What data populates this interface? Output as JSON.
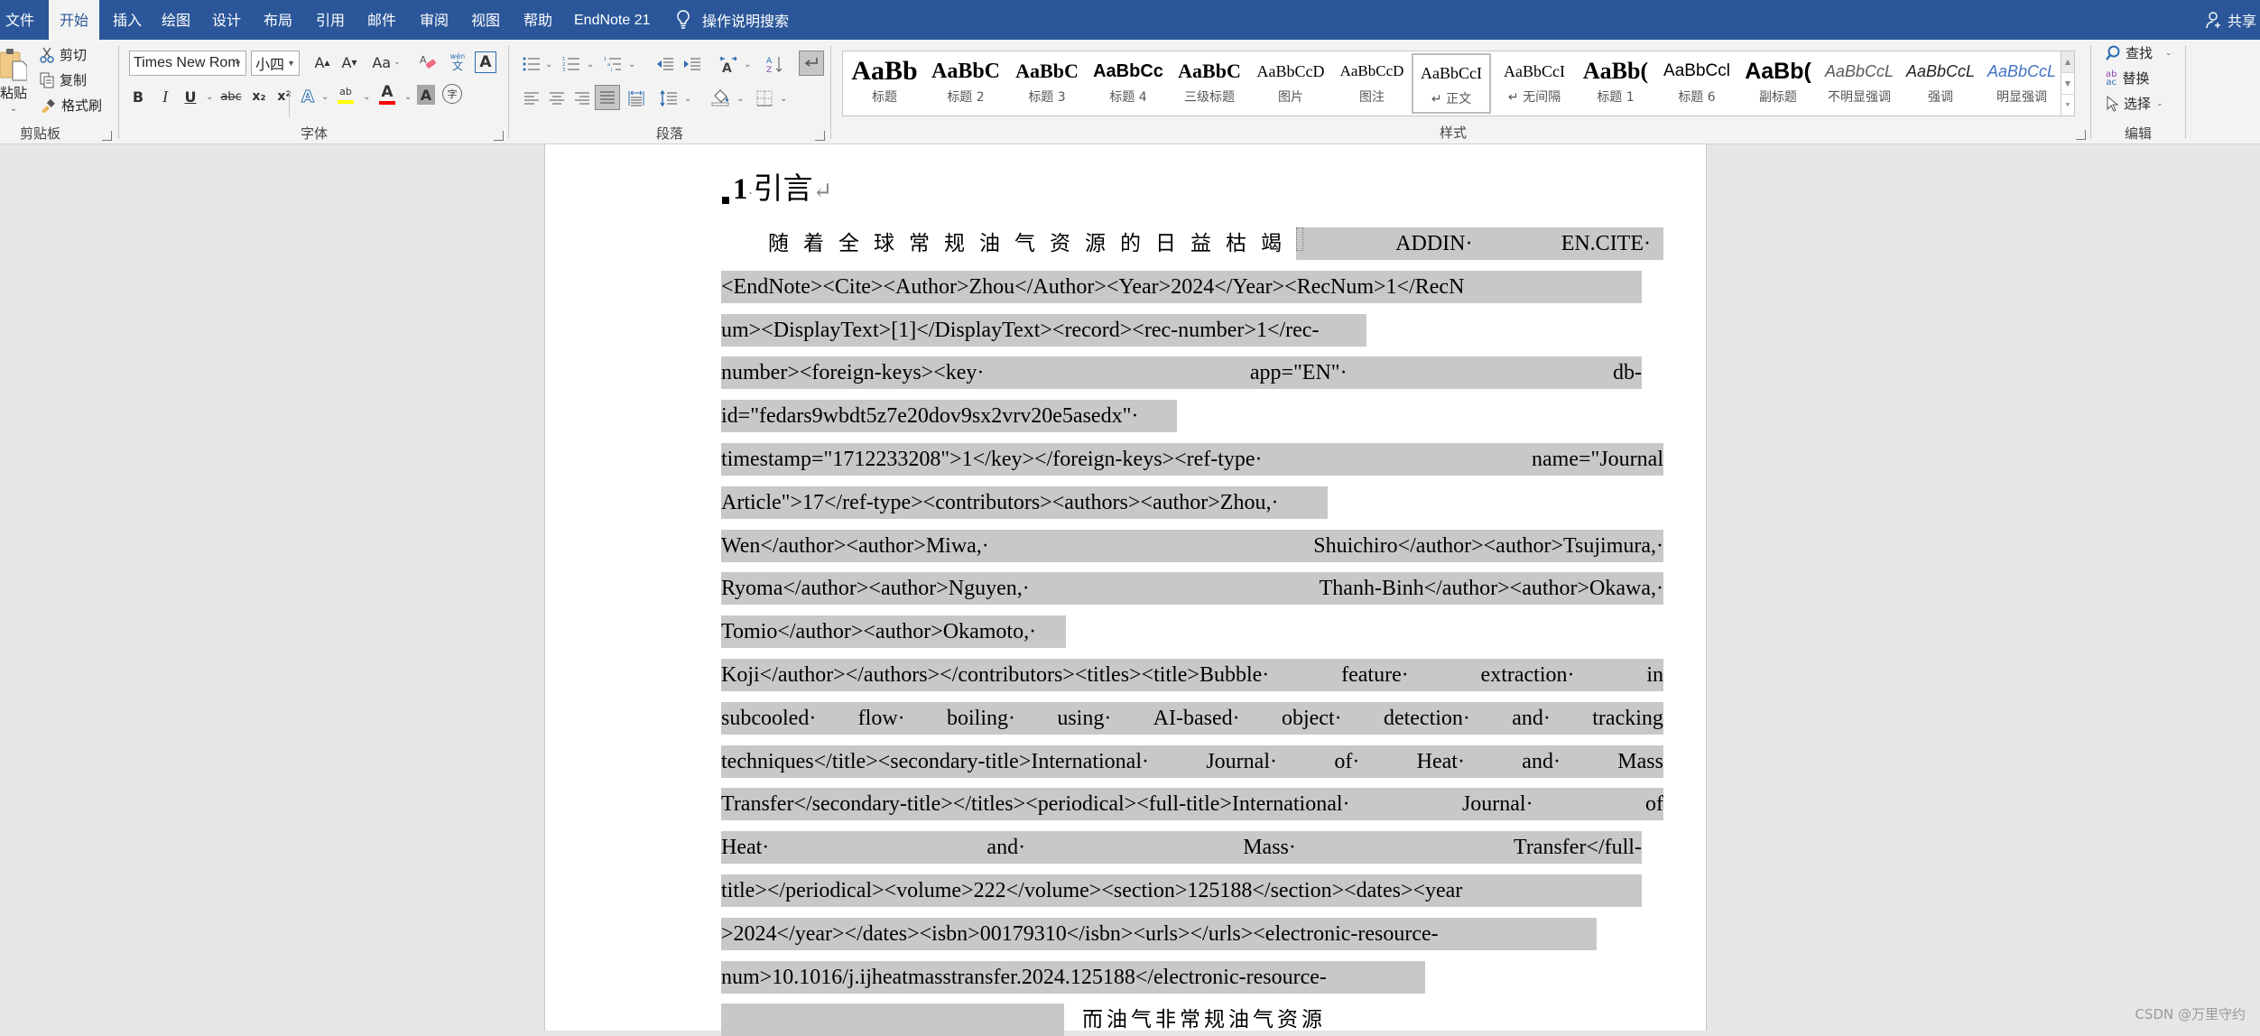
{
  "tabs": {
    "items": [
      {
        "label": "文件"
      },
      {
        "label": "开始"
      },
      {
        "label": "插入"
      },
      {
        "label": "绘图"
      },
      {
        "label": "设计"
      },
      {
        "label": "布局"
      },
      {
        "label": "引用"
      },
      {
        "label": "邮件"
      },
      {
        "label": "审阅"
      },
      {
        "label": "视图"
      },
      {
        "label": "帮助"
      },
      {
        "label": "EndNote 21"
      }
    ],
    "active": "开始",
    "tell_me": "操作说明搜索",
    "share": "共享"
  },
  "ribbon": {
    "clipboard": {
      "label": "剪贴板",
      "paste": "粘贴",
      "cut": "剪切",
      "copy": "复制",
      "format_painter": "格式刷"
    },
    "font": {
      "label": "字体",
      "font_name": "Times New Rom",
      "font_size": "小四",
      "grow": "A",
      "shrink": "A",
      "change_case": "Aa",
      "bold": "B",
      "italic": "I",
      "underline": "U",
      "strike": "abc",
      "subscript": "x₂",
      "superscript": "x²",
      "phonetic_top": "wén",
      "phonetic_bottom": "文",
      "char_border": "A",
      "text_effects": "A",
      "highlight": "ab",
      "highlight_color": "#ffff00",
      "font_color": "A",
      "font_color_value": "#ff0000",
      "char_shading": "A",
      "enclose": "字"
    },
    "paragraph": {
      "label": "段落"
    },
    "styles": {
      "label": "样式",
      "items": [
        {
          "preview": "AaBb",
          "name": "标题"
        },
        {
          "preview": "AaBbC",
          "name": "标题 2"
        },
        {
          "preview": "AaBbC",
          "name": "标题 3"
        },
        {
          "preview": "AaBbCc",
          "name": "标题 4"
        },
        {
          "preview": "AaBbC",
          "name": "三级标题"
        },
        {
          "preview": "AaBbCcD",
          "name": "图片"
        },
        {
          "preview": "AaBbCcD",
          "name": "图注"
        },
        {
          "preview": "AaBbCcI",
          "name": "↵ 正文"
        },
        {
          "preview": "AaBbCcI",
          "name": "↵ 无间隔"
        },
        {
          "preview": "AaBb(",
          "name": "标题 1"
        },
        {
          "preview": "AaBbCcl",
          "name": "标题 6"
        },
        {
          "preview": "AaBb(",
          "name": "副标题"
        },
        {
          "preview": "AaBbCcL",
          "name": "不明显强调"
        },
        {
          "preview": "AaBbCcL",
          "name": "强调"
        },
        {
          "preview": "AaBbCcL",
          "name": "明显强调"
        }
      ],
      "selected": "↵ 正文",
      "intense_emphasis_color": "#4472c4"
    },
    "editing": {
      "label": "编辑",
      "find": "查找",
      "replace": "替换",
      "select": "选择",
      "replace_icon_top": "ab",
      "replace_icon_bottom": "ac"
    }
  },
  "document": {
    "heading": {
      "number": "1",
      "text": "引言"
    },
    "intro_cjk": "随着全球常规油气资源的日益枯竭",
    "lines": [
      {
        "parts": [
          "ADDIN",
          "EN.CITE"
        ]
      },
      {
        "parts": [
          "<EndNote><Cite><Author>Zhou</Author><Year>2024</Year><RecNum>1</RecN"
        ]
      },
      {
        "parts": [
          "um><DisplayText>[1]</DisplayText><record><rec-number>1</rec-"
        ]
      },
      {
        "parts": [
          "number><foreign-keys><key",
          "app=\"EN\"",
          "db-"
        ]
      },
      {
        "parts": [
          "id=\"fedars9wbdt5z7e20dov9sx2vrv20e5asedx\""
        ]
      },
      {
        "parts": [
          "timestamp=\"1712233208\">1</key></foreign-keys><ref-type",
          "name=\"Journal"
        ]
      },
      {
        "parts": [
          "Article\">17</ref-type><contributors><authors><author>Zhou,"
        ]
      },
      {
        "parts": [
          "Wen</author><author>Miwa,",
          "Shuichiro</author><author>Tsujimura,"
        ]
      },
      {
        "parts": [
          "Ryoma</author><author>Nguyen,",
          "Thanh-Binh</author><author>Okawa,"
        ]
      },
      {
        "parts": [
          "Tomio</author><author>Okamoto,"
        ]
      },
      {
        "parts": [
          "Koji</author></authors></contributors><titles><title>Bubble",
          "feature",
          "extraction",
          "in"
        ]
      },
      {
        "parts": [
          "subcooled",
          "flow",
          "boiling",
          "using",
          "AI-based",
          "object",
          "detection",
          "and",
          "tracking"
        ]
      },
      {
        "parts": [
          "techniques</title><secondary-title>International",
          "Journal",
          "of",
          "Heat",
          "and",
          "Mass"
        ]
      },
      {
        "parts": [
          "Transfer</secondary-title></titles><periodical><full-title>International",
          "Journal",
          "of"
        ]
      },
      {
        "parts": [
          "Heat",
          "and",
          "Mass",
          "Transfer</full-"
        ]
      },
      {
        "parts": [
          "title></periodical><volume>222</volume><section>125188</section><dates><year"
        ]
      },
      {
        "parts": [
          ">2024</year></dates><isbn>00179310</isbn><urls></urls><electronic-resource-"
        ]
      },
      {
        "parts": [
          "num>10.1016/j.ijheatmasstransfer.2024.125188</electronic-resource-"
        ]
      }
    ],
    "partial_last_line_cjk": "而油气非常规油气资源"
  },
  "watermark": "CSDN @万里守约"
}
